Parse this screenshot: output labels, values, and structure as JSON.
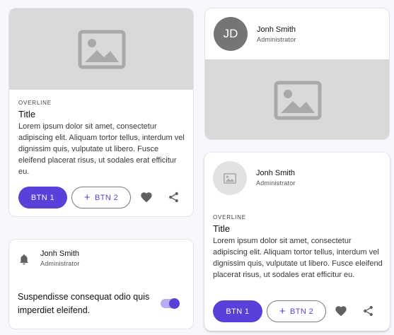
{
  "card1": {
    "overline": "OVERLINE",
    "title": "Title",
    "body": "Lorem ipsum dolor sit amet, consectetur adipiscing elit. Aliquam tortor tellus, interdum vel dignissim quis, vulputate ut libero. Fusce eleifend placerat risus, ut sodales erat efficitur eu.",
    "btn1": "BTN 1",
    "btn2": "BTN 2",
    "icons": [
      "image-placeholder-icon",
      "plus-icon",
      "heart-icon",
      "share-icon"
    ]
  },
  "card2": {
    "avatar_initials": "JD",
    "name": "Jonh Smith",
    "role": "Administrator",
    "icons": [
      "image-placeholder-icon"
    ]
  },
  "card3": {
    "name": "Jonh Smith",
    "role": "Administrator",
    "text": "Suspendisse consequat odio quis imperdiet eleifend.",
    "switch_on": true,
    "icons": [
      "bell-icon"
    ]
  },
  "card4": {
    "name": "Jonh Smith",
    "role": "Administrator",
    "overline": "OVERLINE",
    "title": "Title",
    "body": "Lorem ipsum dolor sit amet, consectetur adipiscing elit. Aliquam tortor tellus, interdum vel dignissim quis, vulputate ut libero. Fusce eleifend placerat risus, ut sodales erat efficitur eu.",
    "btn1": "BTN 1",
    "btn2": "BTN 2",
    "icons": [
      "image-avatar-icon",
      "plus-icon",
      "heart-icon",
      "share-icon"
    ]
  },
  "colors": {
    "primary": "#5b3fd9",
    "media_gray": "#d9d9d9",
    "avatar_gray": "#757575",
    "background": "#f8f7fd"
  }
}
